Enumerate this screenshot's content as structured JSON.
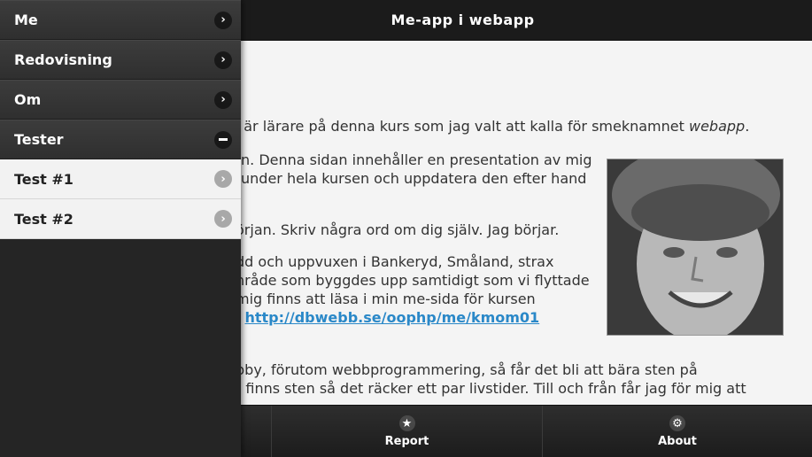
{
  "header": {
    "title": "Me-app i webapp"
  },
  "content": {
    "line1_text": "n är lärare på denna kurs som jag valt att kalla för smeknamnet ",
    "line1_em": "webapp",
    "line1_end": ".",
    "line2": "n. Denna sidan innehåller en presentation av mig",
    "line3": "under hela kursen och uppdatera den efter hand",
    "line4": "örjan. Skriv några ord om dig själv. Jag börjar.",
    "line5": "dd och uppvuxen i Bankeryd, Småland, strax",
    "line6": "nråde som byggdes upp samtidigt som vi flyttade",
    "line7": "mig finns att läsa i min me-sida för kursen",
    "line8_prefix": ": ",
    "line8_link": "http://dbwebb.se/oophp/me/kmom01",
    "line9": "bby, förutom webbprogrammering, så får det bli att bära sten på",
    "line10": "t finns sten så det räcker ett par livstider. Till och från får jag för mig att"
  },
  "panel": {
    "items": [
      {
        "label": "Me",
        "icon": "chevron-right-icon"
      },
      {
        "label": "Redovisning",
        "icon": "chevron-right-icon"
      },
      {
        "label": "Om",
        "icon": "chevron-right-icon"
      },
      {
        "label": "Tester",
        "icon": "minus-icon"
      },
      {
        "label": "Test #1",
        "icon": "chevron-right-icon"
      },
      {
        "label": "Test #2",
        "icon": "chevron-right-icon"
      }
    ]
  },
  "footer": {
    "report_label": "Report",
    "report_icon": "star-icon",
    "about_label": "About",
    "about_icon": "gear-icon"
  }
}
